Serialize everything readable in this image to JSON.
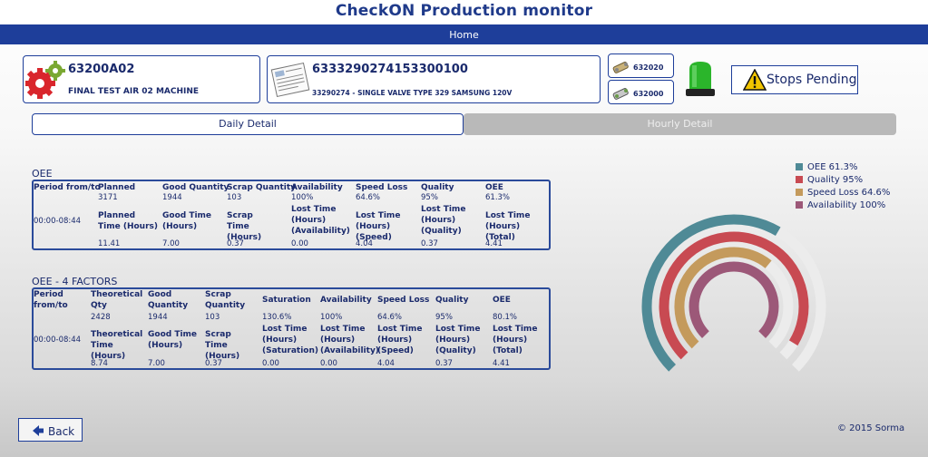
{
  "header": {
    "title": "CheckON Production monitor",
    "home": "Home"
  },
  "machine": {
    "code": "63200A02",
    "description": "FINAL TEST AIR 02 MACHINE",
    "icon": "gears-icon"
  },
  "product": {
    "code": "6333290274153300100",
    "description": "33290274 - SINGLE VALVE TYPE 329 SAMSUNG 120V",
    "icon": "document-icon"
  },
  "codes": [
    {
      "value": "632020",
      "icon": "component-icon"
    },
    {
      "value": "632000",
      "icon": "component-icon"
    }
  ],
  "beacon": {
    "icon": "green-beacon-icon",
    "color": "#2bb52b"
  },
  "stops": {
    "label": "Stops Pending",
    "icon": "warning-icon"
  },
  "tabs": {
    "daily": "Daily Detail",
    "hourly": "Hourly Detail"
  },
  "oee": {
    "title": "OEE",
    "headers": [
      "Period from/to",
      "Planned",
      "Good Quantity",
      "Scrap Quantity",
      "Availability",
      "Speed Loss",
      "Quality",
      "OEE"
    ],
    "values": [
      "3171",
      "1944",
      "103",
      "100%",
      "64.6%",
      "95%",
      "61.3%"
    ],
    "period": "00:00-08:44",
    "time_headers": [
      "Planned Time (Hours)",
      "Good Time (Hours)",
      "Scrap Time (Hours)",
      "Lost Time (Hours) (Availability)",
      "Lost Time (Hours) (Speed)",
      "Lost Time (Hours) (Quality)",
      "Lost Time (Hours) (Total)"
    ],
    "time_values": [
      "11.41",
      "7.00",
      "0.37",
      "0.00",
      "4.04",
      "0.37",
      "4.41"
    ]
  },
  "oee4": {
    "title": "OEE - 4 FACTORS",
    "headers": [
      "Period from/to",
      "Theoretical Qty",
      "Good Quantity",
      "Scrap Quantity",
      "Saturation",
      "Availability",
      "Speed Loss",
      "Quality",
      "OEE"
    ],
    "values": [
      "2428",
      "1944",
      "103",
      "130.6%",
      "100%",
      "64.6%",
      "95%",
      "80.1%"
    ],
    "period": "00:00-08:44",
    "time_headers": [
      "Theoretical Time (Hours)",
      "Good Time (Hours)",
      "Scrap Time (Hours)",
      "Lost Time (Hours) (Saturation)",
      "Lost Time (Hours) (Availability)",
      "Lost Time (Hours) (Speed)",
      "Lost Time (Hours) (Quality)",
      "Lost Time (Hours) (Total)"
    ],
    "time_values": [
      "8.74",
      "7.00",
      "0.37",
      "0.00",
      "0.00",
      "4.04",
      "0.37",
      "4.41"
    ]
  },
  "chart_data": {
    "type": "radial-bar",
    "series": [
      {
        "name": "OEE 61.3%",
        "value": 61.3,
        "color": "#4f8a96"
      },
      {
        "name": "Quality 95%",
        "value": 95,
        "color": "#c84a52"
      },
      {
        "name": "Speed Loss 64.6%",
        "value": 64.6,
        "color": "#c49a5c"
      },
      {
        "name": "Availability 100%",
        "value": 100,
        "color": "#9c5878"
      }
    ],
    "track_color": "#ececec",
    "range": [
      0,
      100
    ]
  },
  "footer": {
    "back": "Back",
    "copyright": "© 2015 Sorma"
  }
}
